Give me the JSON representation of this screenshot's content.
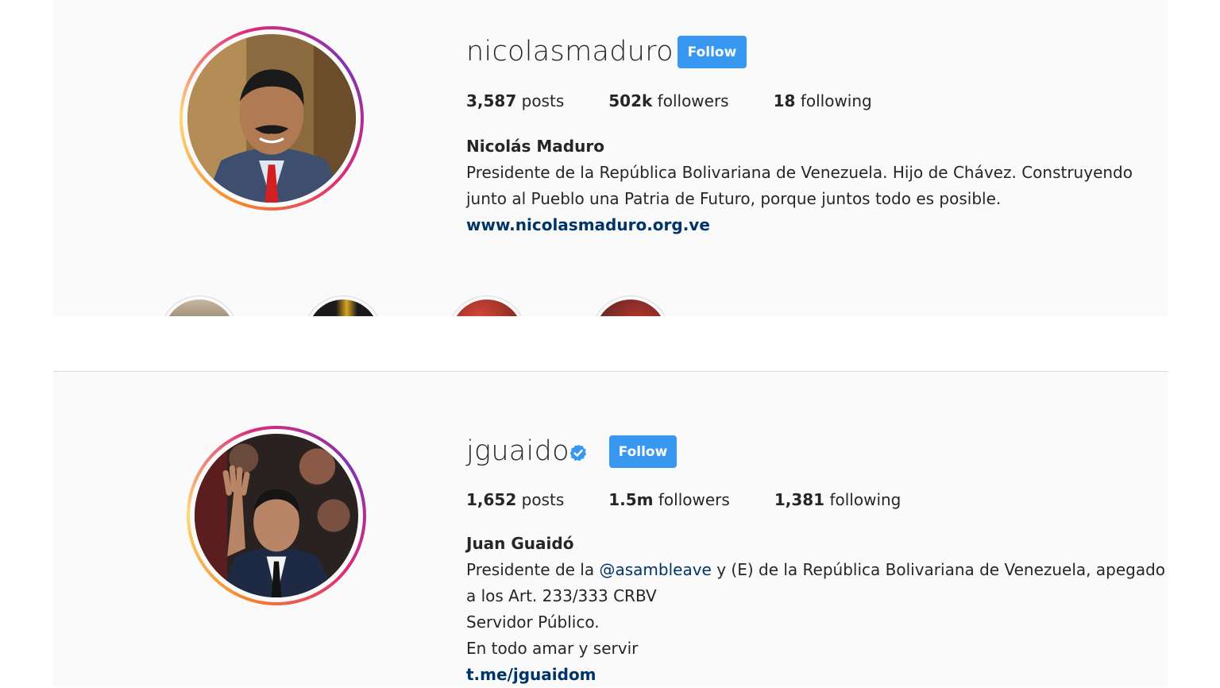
{
  "profiles": [
    {
      "username": "nicolasmaduro",
      "follow_label": "Follow",
      "verified": false,
      "posts_count": "3,587",
      "posts_label": "posts",
      "followers_count": "502k",
      "followers_label": "followers",
      "following_count": "18",
      "following_label": "following",
      "full_name": "Nicolás Maduro",
      "bio_lines": [
        "Presidente de la República Bolivariana de Venezuela. Hijo de Chávez. Construyendo",
        "junto al Pueblo una Patria de Futuro, porque juntos todo es posible."
      ],
      "website": "www.nicolasmaduro.org.ve"
    },
    {
      "username": "jguaido",
      "follow_label": "Follow",
      "verified": true,
      "posts_count": "1,652",
      "posts_label": "posts",
      "followers_count": "1.5m",
      "followers_label": "followers",
      "following_count": "1,381",
      "following_label": "following",
      "full_name": "Juan Guaidó",
      "bio_line1_pre": "Presidente de la ",
      "bio_mention": "@asambleave",
      "bio_line1_post": " y (E) de la República Bolivariana de Venezuela, apegado",
      "bio_lines_rest": [
        "a los Art. 233/333 CRBV",
        "Servidor Público.",
        "En todo amar y servir"
      ],
      "website": "t.me/jguaidom"
    }
  ],
  "icons": {
    "verified_badge": "verified-badge-icon"
  },
  "colors": {
    "follow_button": "#3897f0",
    "link": "#003569",
    "panel_bg": "#fafafa",
    "verified": "#3897f0"
  }
}
